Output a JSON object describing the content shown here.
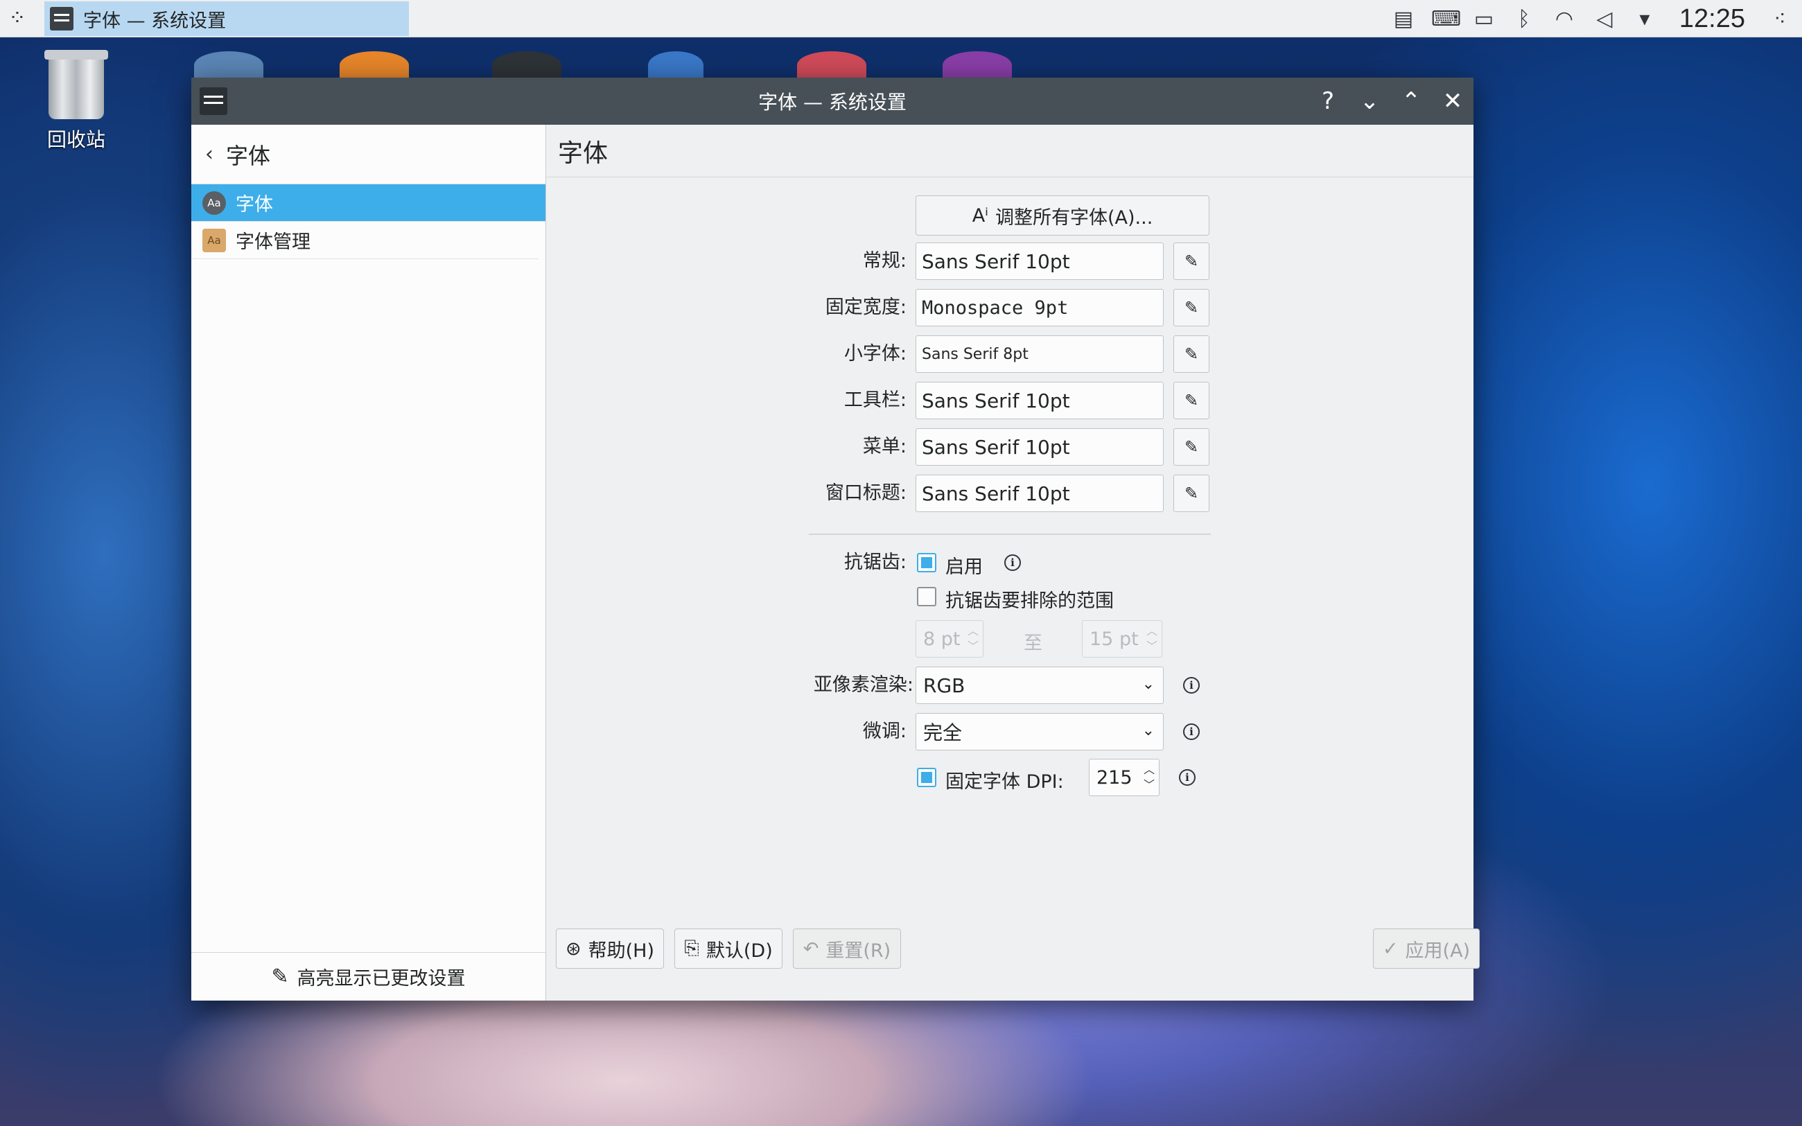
{
  "panel": {
    "launcher_icon": "kde-launcher-icon",
    "task_title": "字体 — 系统设置",
    "tray_icons": [
      "clipboard-icon",
      "keyboard-icon",
      "battery-icon",
      "bluetooth-icon",
      "wifi-icon",
      "volume-muted-icon",
      "tray-expand-icon"
    ],
    "clock": "12:25"
  },
  "desktop": {
    "trash_label": "回收站"
  },
  "window": {
    "title": "字体 — 系统设置",
    "controls": {
      "help": "?",
      "minimize": "⌄",
      "maximize": "⌃",
      "close": "✕"
    }
  },
  "sidebar": {
    "back_title": "字体",
    "items": [
      {
        "label": "字体",
        "selected": true,
        "icon": "fonts-icon"
      },
      {
        "label": "字体管理",
        "selected": false,
        "icon": "font-manager-icon"
      }
    ],
    "footer_label": "高亮显示已更改设置"
  },
  "main": {
    "page_title": "字体",
    "adjust_all_button": "调整所有字体(A)...",
    "fonts": [
      {
        "label": "常规:",
        "value": "Sans Serif 10pt"
      },
      {
        "label": "固定宽度:",
        "value": "Monospace 9pt"
      },
      {
        "label": "小字体:",
        "value": "Sans Serif 8pt"
      },
      {
        "label": "工具栏:",
        "value": "Sans Serif 10pt"
      },
      {
        "label": "菜单:",
        "value": "Sans Serif 10pt"
      },
      {
        "label": "窗口标题:",
        "value": "Sans Serif 10pt"
      }
    ],
    "antialias": {
      "label": "抗锯齿:",
      "enable_label": "启用",
      "enable_checked": true,
      "exclude_label": "抗锯齿要排除的范围",
      "exclude_checked": false,
      "range_from": "8 pt",
      "range_to_word": "至",
      "range_to": "15 pt"
    },
    "subpixel": {
      "label": "亚像素渲染:",
      "value": "RGB"
    },
    "hinting": {
      "label": "微调:",
      "value": "完全"
    },
    "dpi": {
      "label": "固定字体 DPI:",
      "checked": true,
      "value": "215"
    }
  },
  "buttons": {
    "help": "帮助(H)",
    "defaults": "默认(D)",
    "reset": "重置(R)",
    "apply": "应用(A)"
  },
  "colors": {
    "accent": "#3daee9",
    "titlebar": "#475057",
    "panel": "#eff0f1"
  }
}
